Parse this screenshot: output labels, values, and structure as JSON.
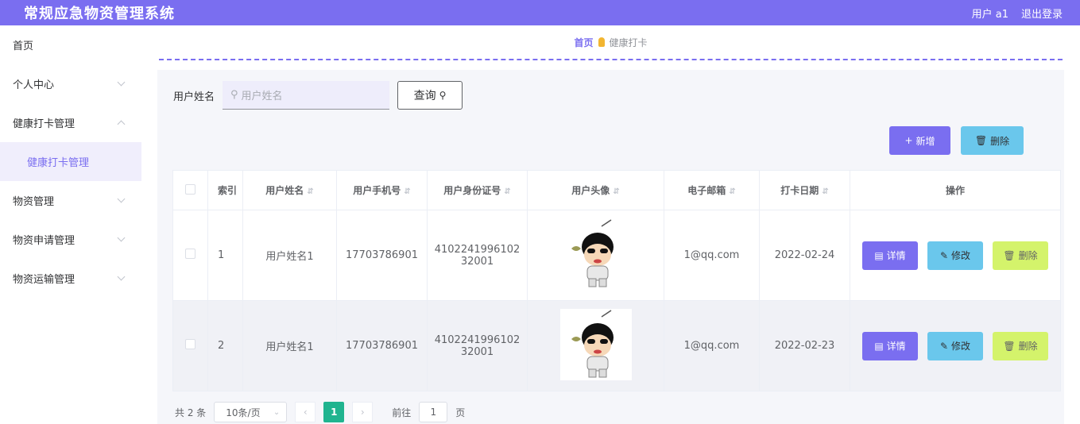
{
  "header": {
    "title": "常规应急物资管理系统",
    "user": "用户 a1",
    "logout": "退出登录"
  },
  "sidebar": {
    "items": [
      {
        "label": "首页"
      },
      {
        "label": "个人中心"
      },
      {
        "label": "健康打卡管理"
      },
      {
        "label": "健康打卡管理",
        "sub": true
      },
      {
        "label": "物资管理"
      },
      {
        "label": "物资申请管理"
      },
      {
        "label": "物资运输管理"
      }
    ]
  },
  "breadcrumb": {
    "home": "首页",
    "current": "健康打卡"
  },
  "search": {
    "label": "用户姓名",
    "placeholder": "用户姓名",
    "button": "查询"
  },
  "actions": {
    "add": "新增",
    "delete": "删除"
  },
  "table": {
    "headers": [
      "索引",
      "用户姓名",
      "用户手机号",
      "用户身份证号",
      "用户头像",
      "电子邮箱",
      "打卡日期",
      "操作"
    ],
    "rows": [
      {
        "index": "1",
        "name": "用户姓名1",
        "phone": "17703786901",
        "id_line1": "4102241996102",
        "id_line2": "32001",
        "email": "1@qq.com",
        "date": "2022-02-24"
      },
      {
        "index": "2",
        "name": "用户姓名1",
        "phone": "17703786901",
        "id_line1": "4102241996102",
        "id_line2": "32001",
        "email": "1@qq.com",
        "date": "2022-02-23"
      }
    ],
    "ops": {
      "detail": "详情",
      "edit": "修改",
      "remove": "删除"
    }
  },
  "pager": {
    "total": "共 2 条",
    "size": "10条/页",
    "current_page": "1",
    "goto": "前往",
    "goto_value": "1",
    "page_suffix": "页"
  },
  "colors": {
    "accent": "#7a6ef0",
    "cyan": "#6ac7ec",
    "lime": "#d4f36b",
    "green": "#20b48f"
  }
}
